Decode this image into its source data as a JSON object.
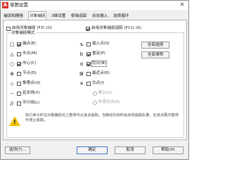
{
  "window": {
    "title": "草图设置",
    "app_icon_letter": "A",
    "close_glyph": "✕"
  },
  "tabs": [
    {
      "label": "捕捉和栅格"
    },
    {
      "label": "对象捕捉"
    },
    {
      "label": "3维设置"
    },
    {
      "label": "极轴追踪"
    },
    {
      "label": "动态输入"
    },
    {
      "label": "选择循环"
    }
  ],
  "options": {
    "enable_osnap_label": "启用对象捕捉 (F3) (O)",
    "enable_osnap_checked": false,
    "enable_tracking_label": "启用对象捕捉追踪 (F11) (K)",
    "enable_tracking_checked": true
  },
  "group_title": "对象捕捉模式",
  "snap_left": [
    {
      "symbol": "□",
      "label": "端点(E)",
      "checked": true
    },
    {
      "symbol": "△",
      "label": "中点(M)",
      "checked": false
    },
    {
      "symbol": "○",
      "label": "中心(C)",
      "checked": true
    },
    {
      "symbol": "⊗",
      "label": "节点(D)",
      "checked": false
    },
    {
      "symbol": "◇",
      "label": "象限点(Q)",
      "checked": false
    },
    {
      "symbol": "--",
      "label": "延长线(X)",
      "checked": false
    },
    {
      "symbol": "//",
      "label": "平行线(L)",
      "checked": false
    }
  ],
  "snap_right": [
    {
      "symbol": "ъ",
      "label": "插入点(S)",
      "checked": false
    },
    {
      "symbol": "b",
      "label": "垂足(P)",
      "checked": true
    },
    {
      "symbol": "ɑ",
      "label": "切点(N)",
      "checked": true
    },
    {
      "symbol": "⊠",
      "label": "最近点(R)",
      "checked": false
    },
    {
      "symbol": "✕",
      "label": "交点(I)",
      "checked": false
    }
  ],
  "intersection_radios": [
    {
      "label": "默认(U)"
    },
    {
      "label": "外观交点(A)"
    }
  ],
  "buttons": {
    "select_all": "全部选择",
    "clear_all": "全部清除",
    "options": "选项(T)...",
    "ok": "确定",
    "cancel": "取消",
    "help": "帮助(H)"
  },
  "hint_text": "执行命令时在对象捕捉点上暂停可从该点追踪，当移动光标时会出现追踪矢量，在该点再次暂停可停止追踪。",
  "colors": {
    "warning": "#f2c200",
    "default_button_border": "#3a79c8"
  }
}
